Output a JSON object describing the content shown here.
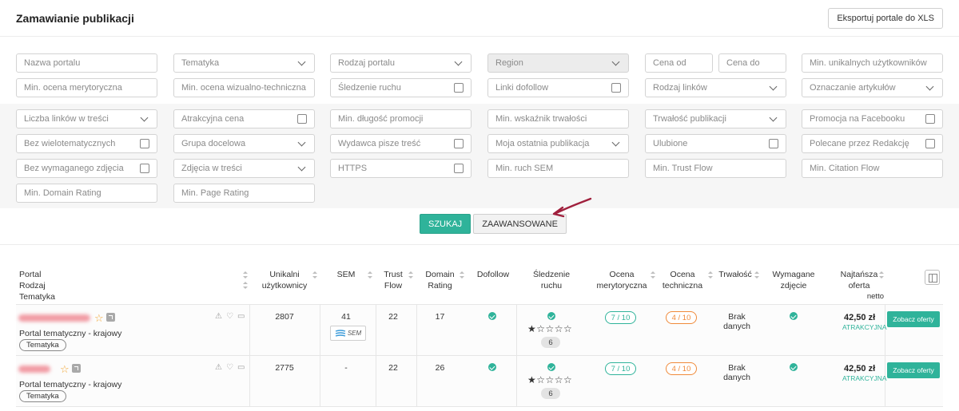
{
  "header": {
    "title": "Zamawianie publikacji",
    "export_label": "Eksportuj portale do XLS"
  },
  "filters": {
    "portal_name": "Nazwa portalu",
    "topic": "Tematyka",
    "portal_type": "Rodzaj portalu",
    "region": "Region",
    "price_from": "Cena od",
    "price_to": "Cena do",
    "min_unique_users": "Min. unikalnych użytkowników",
    "min_content_rating": "Min. ocena merytoryczna",
    "min_visual_rating": "Min. ocena wizualno-techniczna",
    "traffic_tracking": "Śledzenie ruchu",
    "dofollow_links": "Linki dofollow",
    "link_type": "Rodzaj linków",
    "article_marking": "Oznaczanie artykułów",
    "links_in_content": "Liczba linków w treści",
    "attractive_price": "Atrakcyjna cena",
    "min_promo_length": "Min. długość promocji",
    "min_durability": "Min. wskaźnik trwałości",
    "publication_durability": "Trwałość publikacji",
    "facebook_promo": "Promocja na Facebooku",
    "no_multitopic": "Bez wielotematycznych",
    "target_group": "Grupa docelowa",
    "publisher_writes": "Wydawca pisze treść",
    "my_last_publication": "Moja ostatnia publikacja",
    "favorites": "Ulubione",
    "editors_choice": "Polecane przez Redakcję",
    "no_required_photo": "Bez wymaganego zdjęcia",
    "photos_in_content": "Zdjęcia w treści",
    "https": "HTTPS",
    "min_sem_traffic": "Min. ruch SEM",
    "min_trust_flow": "Min. Trust Flow",
    "min_citation_flow": "Min. Citation Flow",
    "min_domain_rating": "Min. Domain Rating",
    "min_page_rating": "Min. Page Rating"
  },
  "actions": {
    "search_label": "SZUKAJ",
    "advanced_label": "ZAAWANSOWANE"
  },
  "table": {
    "headers": {
      "portal": "Portal",
      "type": "Rodzaj",
      "topic": "Tematyka",
      "unique_users_1": "Unikalni",
      "unique_users_2": "użytkownicy",
      "sem": "SEM",
      "trust_flow_1": "Trust",
      "trust_flow_2": "Flow",
      "domain_rating_1": "Domain",
      "domain_rating_2": "Rating",
      "dofollow": "Dofollow",
      "tracking_1": "Śledzenie",
      "tracking_2": "ruchu",
      "content_rating_1": "Ocena",
      "content_rating_2": "merytoryczna",
      "tech_rating_1": "Ocena",
      "tech_rating_2": "techniczna",
      "durability": "Trwałość",
      "photo_required_1": "Wymagane",
      "photo_required_2": "zdjęcie",
      "lowest_offer_1": "Najtańsza",
      "lowest_offer_2": "oferta",
      "lowest_offer_3": "netto"
    },
    "rows": [
      {
        "portal_type": "Portal tematyczny - krajowy",
        "tag": "Tematyka",
        "unique_users": "2807",
        "sem": "41",
        "sem_badge": "SEM",
        "trust_flow": "22",
        "domain_rating": "17",
        "stars": "★☆☆☆☆",
        "tracking_count": "6",
        "content_rating": "7 / 10",
        "tech_rating": "4 / 10",
        "durability": "Brak danych",
        "price": "42,50 zł",
        "price_tag": "ATRAKCYJNA",
        "offer_label": "Zobacz oferty"
      },
      {
        "portal_type": "Portal tematyczny - krajowy",
        "tag": "Tematyka",
        "unique_users": "2775",
        "sem": "-",
        "trust_flow": "22",
        "domain_rating": "26",
        "stars": "★☆☆☆☆",
        "tracking_count": "6",
        "content_rating": "7 / 10",
        "tech_rating": "4 / 10",
        "durability": "Brak danych",
        "price": "42,50 zł",
        "price_tag": "ATRAKCYJNA",
        "offer_label": "Zobacz oferty"
      }
    ]
  },
  "colors": {
    "accent": "#2fb39a",
    "warning": "#f08a3a",
    "favorite": "#f1a533",
    "arrow": "#a0203d"
  }
}
